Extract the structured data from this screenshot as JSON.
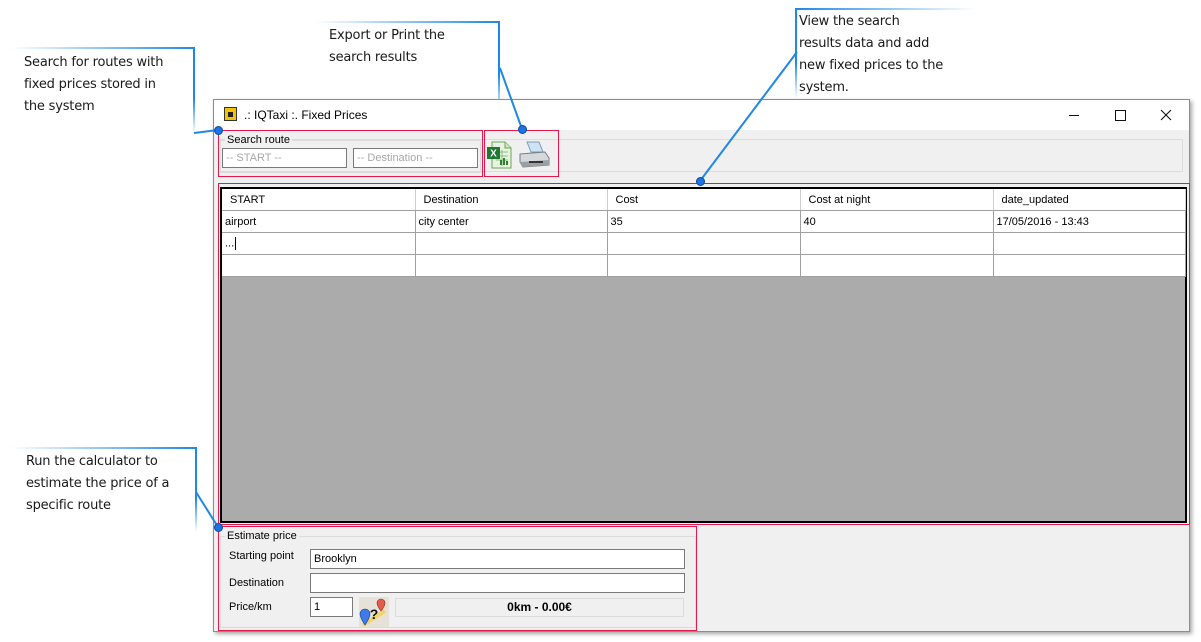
{
  "annotations": {
    "search": [
      "Search for routes with",
      "fixed prices stored in",
      "the system"
    ],
    "export": [
      "Export or Print the",
      "search results"
    ],
    "view": [
      "View the search",
      "results data and add",
      "new fixed prices to the",
      "system."
    ],
    "estimate": [
      "Run the calculator to",
      "estimate the price of a",
      "specific route"
    ]
  },
  "window": {
    "title": ".: IQTaxi :. Fixed Prices",
    "icon": "taxi-app-icon",
    "controls": {
      "minimize": "minimize",
      "maximize": "maximize",
      "close": "close"
    }
  },
  "search_route": {
    "label": "Search route",
    "start_placeholder": "-- START --",
    "destination_placeholder": "-- Destination --"
  },
  "toolbar": {
    "export_icon": "excel-export-icon",
    "print_icon": "printer-icon"
  },
  "grid": {
    "columns": [
      "START",
      "Destination",
      "Cost",
      "Cost at night",
      "date_updated"
    ],
    "rows": [
      [
        "airport",
        "city center",
        "35",
        "40",
        "17/05/2016 - 13:43"
      ],
      [
        "...",
        "",
        "",
        "",
        ""
      ],
      [
        "",
        "",
        "",
        "",
        ""
      ]
    ]
  },
  "estimate": {
    "label": "Estimate price",
    "starting_point_label": "Starting point",
    "starting_point_value": "Brooklyn",
    "destination_label": "Destination",
    "destination_value": "",
    "price_km_label": "Price/km",
    "price_km_value": "1",
    "result": "0km - 0.00€",
    "calc_icon": "route-calculator-icon"
  },
  "colors": {
    "highlight": "#e8174a",
    "callout": "#1e88e5",
    "grid_background": "#ababab"
  }
}
